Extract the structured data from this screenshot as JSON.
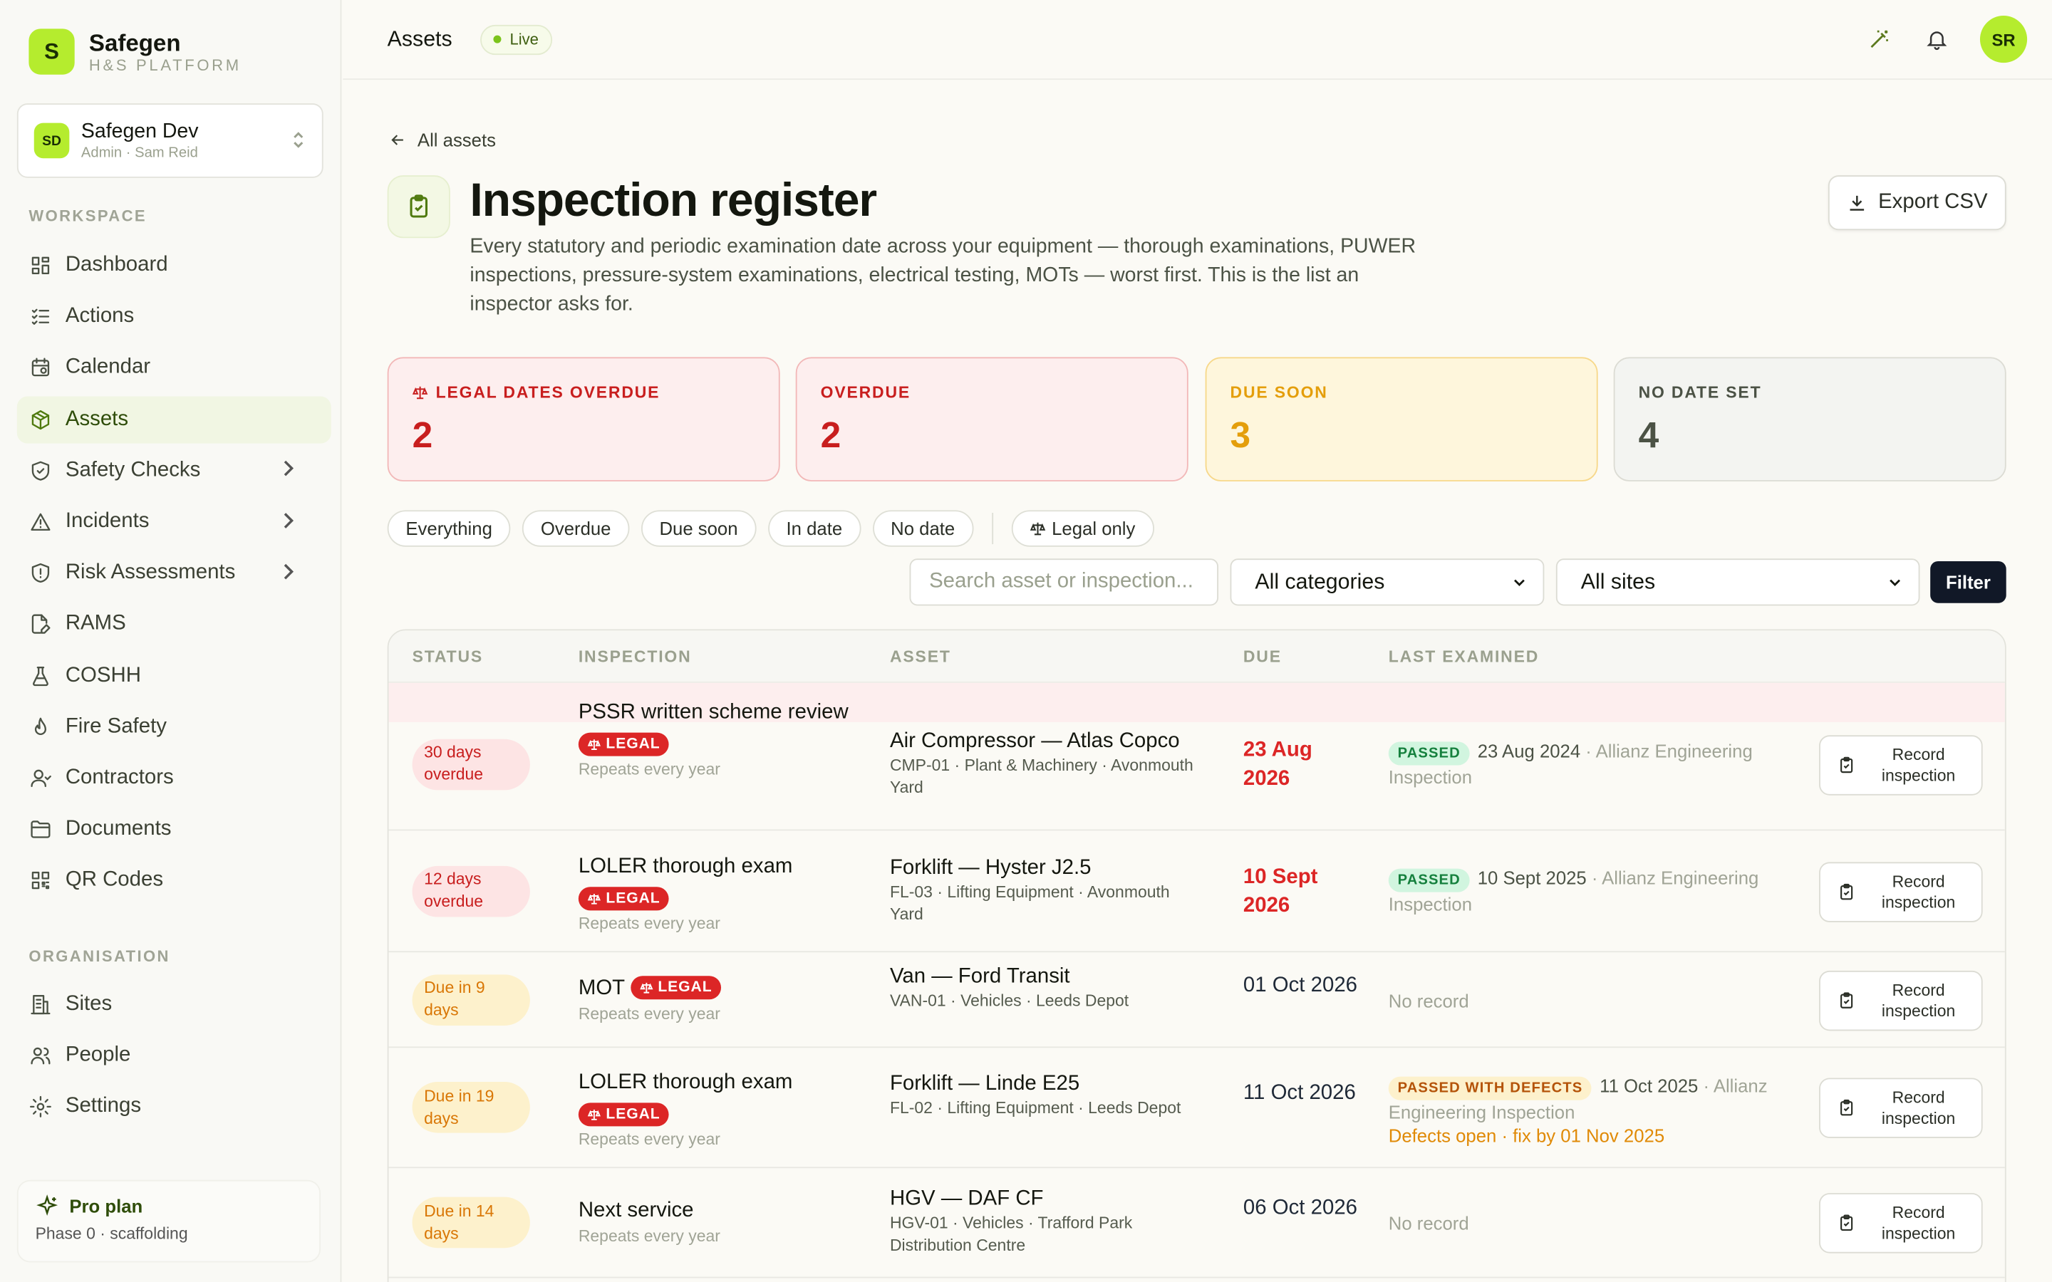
{
  "brand": {
    "logo_letter": "S",
    "name": "Safegen",
    "subtitle": "H&S PLATFORM"
  },
  "org": {
    "initials": "SD",
    "name": "Safegen Dev",
    "sub": "Admin · Sam Reid"
  },
  "sidebar": {
    "workspace_label": "WORKSPACE",
    "workspace": [
      {
        "label": "Dashboard",
        "icon": "dashboard-icon"
      },
      {
        "label": "Actions",
        "icon": "list-check-icon"
      },
      {
        "label": "Calendar",
        "icon": "calendar-icon"
      },
      {
        "label": "Assets",
        "icon": "box-icon",
        "active": true
      },
      {
        "label": "Safety Checks",
        "icon": "shield-check-icon",
        "chevron": true
      },
      {
        "label": "Incidents",
        "icon": "warning-icon",
        "chevron": true
      },
      {
        "label": "Risk Assessments",
        "icon": "shield-alert-icon",
        "chevron": true
      },
      {
        "label": "RAMS",
        "icon": "file-edit-icon"
      },
      {
        "label": "COSHH",
        "icon": "flask-icon"
      },
      {
        "label": "Fire Safety",
        "icon": "flame-icon"
      },
      {
        "label": "Contractors",
        "icon": "user-icon"
      },
      {
        "label": "Documents",
        "icon": "folder-icon"
      },
      {
        "label": "QR Codes",
        "icon": "qr-icon"
      }
    ],
    "organisation_label": "ORGANISATION",
    "organisation": [
      {
        "label": "Sites",
        "icon": "building-icon"
      },
      {
        "label": "People",
        "icon": "people-icon"
      },
      {
        "label": "Settings",
        "icon": "gear-icon"
      }
    ],
    "plan": {
      "title": "Pro plan",
      "sub": "Phase 0 · scaffolding"
    }
  },
  "topbar": {
    "title": "Assets",
    "badge": "Live",
    "user_initials": "SR"
  },
  "page": {
    "back": "All assets",
    "title": "Inspection register",
    "description": "Every statutory and periodic examination date across your equipment — thorough examinations, PUWER inspections, pressure-system examinations, electrical testing, MOTs — worst first. This is the list an inspector asks for.",
    "export": "Export CSV"
  },
  "cards": [
    {
      "label": "LEGAL DATES OVERDUE",
      "value": "2",
      "legal_icon": true,
      "bg": "#fdeeee",
      "border": "#f2b8b8",
      "fg": "#c81e1e",
      "val": "#c81e1e"
    },
    {
      "label": "OVERDUE",
      "value": "2",
      "bg": "#fdeeee",
      "border": "#f2b8b8",
      "fg": "#c81e1e",
      "val": "#c81e1e"
    },
    {
      "label": "DUE SOON",
      "value": "3",
      "bg": "#fef6dc",
      "border": "#f7d88a",
      "fg": "#e49e0b",
      "val": "#e49e0b"
    },
    {
      "label": "NO DATE SET",
      "value": "4",
      "bg": "#f3f4f1",
      "border": "#dcdcd4",
      "fg": "#4b5245",
      "val": "#4b5245"
    }
  ],
  "filters": {
    "chips": [
      "Everything",
      "Overdue",
      "Due soon",
      "In date",
      "No date"
    ],
    "legal_chip": "Legal only",
    "search_placeholder": "Search asset or inspection...",
    "category": "All categories",
    "site": "All sites",
    "button": "Filter"
  },
  "table": {
    "headers": [
      "STATUS",
      "INSPECTION",
      "ASSET",
      "DUE",
      "LAST EXAMINED"
    ],
    "legal_label": "LEGAL",
    "record_label": "Record inspection",
    "rows": [
      {
        "status": "30 days overdue",
        "tone": "red",
        "inspection": "PSSR written scheme review",
        "legal": true,
        "repeats": "Repeats every year",
        "asset": "Air Compressor — Atlas Copco",
        "asset_sub": "CMP-01 · Plant & Machinery · Avonmouth Yard",
        "due": "23 Aug 2026",
        "due_red": true,
        "result": "PASSED",
        "last_date": "23 Aug 2024",
        "examiner": " · Allianz Engineering Inspection"
      },
      {
        "status": "12 days overdue",
        "tone": "red",
        "inspection": "LOLER thorough exam",
        "legal": true,
        "repeats": "Repeats every year",
        "asset": "Forklift — Hyster J2.5",
        "asset_sub": "FL-03 · Lifting Equipment · Avonmouth Yard",
        "due": "10 Sept 2026",
        "due_red": true,
        "result": "PASSED",
        "last_date": "10 Sept 2025",
        "examiner": " · Allianz Engineering Inspection"
      },
      {
        "status": "Due in 9 days",
        "tone": "amb",
        "inspection": "MOT",
        "legal": true,
        "inline_legal": true,
        "repeats": "Repeats every year",
        "asset": "Van — Ford Transit",
        "asset_sub": "VAN-01 · Vehicles · Leeds Depot",
        "due": "01 Oct 2026",
        "due_red": false,
        "no_record": "No record"
      },
      {
        "status": "Due in 19 days",
        "tone": "amb",
        "inspection": "LOLER thorough exam",
        "legal": true,
        "repeats": "Repeats every year",
        "asset": "Forklift — Linde E25",
        "asset_sub": "FL-02 · Lifting Equipment · Leeds Depot",
        "due": "11 Oct 2026",
        "due_red": false,
        "result": "PASSED WITH DEFECTS",
        "last_date": "11 Oct 2025",
        "examiner": " · Allianz Engineering Inspection",
        "defects": "Defects open · fix by 01 Nov 2025"
      },
      {
        "status": "Due in 14 days",
        "tone": "amb",
        "inspection": "Next service",
        "legal": false,
        "repeats": "Repeats every year",
        "asset": "HGV — DAF CF",
        "asset_sub": "HGV-01 · Vehicles · Trafford Park Distribution Centre",
        "due": "06 Oct 2026",
        "due_red": false,
        "no_record": "No record"
      }
    ]
  }
}
